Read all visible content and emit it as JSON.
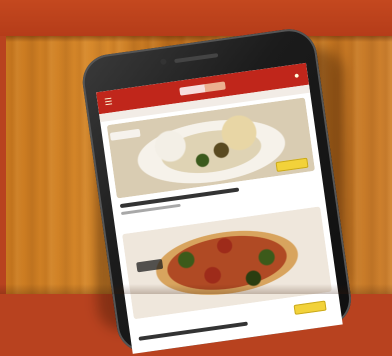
{
  "scene": {
    "description_colors": {
      "banner": "#b8421f",
      "table_wood": "#c9791f",
      "phone_body": "#1b1b1b",
      "app_header": "#c0261b",
      "order_button": "#f2d23a"
    }
  },
  "app": {
    "header_icons": [
      "menu-icon",
      "cart-icon"
    ],
    "cards": [
      {
        "image": "pasta-dish"
      },
      {
        "image": "pizza-dish"
      }
    ]
  }
}
